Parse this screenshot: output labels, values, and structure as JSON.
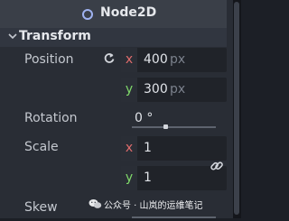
{
  "header": {
    "title": "Node2D",
    "icon": "node2d-circle-icon"
  },
  "section": {
    "label": "Transform",
    "icon": "chevron-down-icon"
  },
  "position": {
    "label": "Position",
    "reset_icon": "revert-icon",
    "x_axis": "x",
    "x_value": "400",
    "x_unit": "px",
    "y_axis": "y",
    "y_value": "300",
    "y_unit": "px"
  },
  "rotation": {
    "label": "Rotation",
    "value": "0 °"
  },
  "scale": {
    "label": "Scale",
    "x_axis": "x",
    "x_value": "1",
    "y_axis": "y",
    "y_value": "1",
    "link_icon": "link-chain-icon"
  },
  "skew": {
    "label": "Skew"
  },
  "watermark": {
    "text": "公众号 · 山岚的运维笔记",
    "icon": "wechat-logo-icon"
  },
  "colors": {
    "x_axis": "#e06c6c",
    "y_axis": "#7fd86a",
    "node_icon": "#9fb2f0"
  }
}
